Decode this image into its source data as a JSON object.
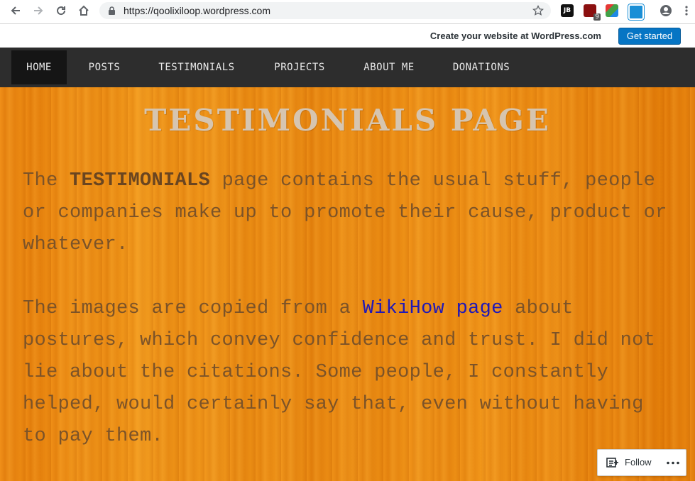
{
  "browser": {
    "url": "https://qoolixiloop.wordpress.com",
    "extension_badge": "9"
  },
  "wp_bar": {
    "promo": "Create your website at WordPress.com",
    "cta": "Get started"
  },
  "nav": {
    "items": [
      "HOME",
      "POSTS",
      "TESTIMONIALS",
      "PROJECTS",
      "ABOUT ME",
      "DONATIONS"
    ],
    "active": "HOME"
  },
  "page": {
    "title": "TESTIMONIALS PAGE",
    "para1": {
      "before": "The ",
      "bold": "TESTIMONIALS",
      "after": " page contains the usual stuff, people or companies make up to promote their cause, product or whatever."
    },
    "para2": {
      "before": "The images are copied from a ",
      "link": "WikiHow page",
      "after": " about postures, which convey confidence and trust. I did not lie about the citations. Some people, I constantly helped, would certainly say that, even without having to pay them."
    }
  },
  "follow": {
    "label": "Follow"
  },
  "colors": {
    "accent": "#0675c4",
    "nav_bg": "#2d2d2d",
    "content_bg": "#ea8a10",
    "link": "#1f18b8"
  }
}
